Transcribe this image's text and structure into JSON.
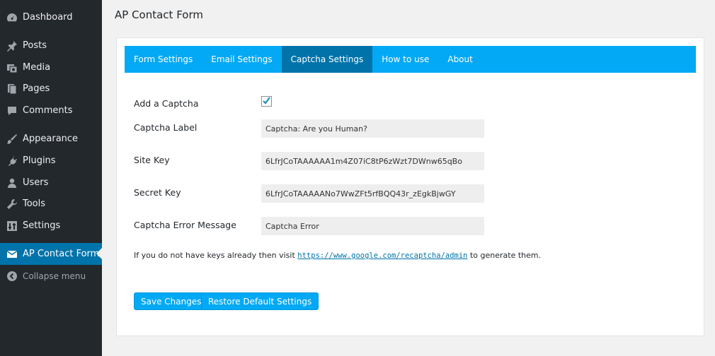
{
  "sidebar": {
    "items": [
      {
        "label": "Dashboard",
        "icon": "dashboard-icon"
      },
      {
        "label": "Posts",
        "icon": "pin-icon"
      },
      {
        "label": "Media",
        "icon": "media-icon"
      },
      {
        "label": "Pages",
        "icon": "pages-icon"
      },
      {
        "label": "Comments",
        "icon": "comment-icon"
      },
      {
        "label": "Appearance",
        "icon": "brush-icon"
      },
      {
        "label": "Plugins",
        "icon": "plugin-icon"
      },
      {
        "label": "Users",
        "icon": "user-icon"
      },
      {
        "label": "Tools",
        "icon": "wrench-icon"
      },
      {
        "label": "Settings",
        "icon": "settings-icon"
      },
      {
        "label": "AP Contact Form",
        "icon": "envelope-icon",
        "active": true
      }
    ],
    "collapse_label": "Collapse menu",
    "colors": {
      "background": "#23282d",
      "active": "#0073aa"
    }
  },
  "page": {
    "title": "AP Contact Form"
  },
  "tabs": [
    {
      "label": "Form Settings"
    },
    {
      "label": "Email Settings"
    },
    {
      "label": "Captcha Settings",
      "active": true
    },
    {
      "label": "How to use"
    },
    {
      "label": "About"
    }
  ],
  "form": {
    "add_captcha": {
      "label": "Add a Captcha",
      "checked": true
    },
    "captcha_label": {
      "label": "Captcha Label",
      "value": "Captcha: Are you Human?"
    },
    "site_key": {
      "label": "Site Key",
      "value": "6LfrJCoTAAAAAA1m4Z07iC8tP6zWzt7DWnw65qBo"
    },
    "secret_key": {
      "label": "Secret Key",
      "value": "6LfrJCoTAAAAANo7WwZFt5rfBQQ43r_zEgkBjwGY"
    },
    "error_message": {
      "label": "Captcha Error Message",
      "value": "Captcha Error"
    }
  },
  "helper": {
    "prefix": "If you do not have keys already then visit ",
    "link": "https://www.google.com/recaptcha/admin",
    "suffix": " to generate them."
  },
  "buttons": {
    "save": "Save Changes",
    "restore": "Restore Default Settings"
  },
  "colors": {
    "accent": "#03a9f4",
    "tab_active": "#0073aa"
  }
}
